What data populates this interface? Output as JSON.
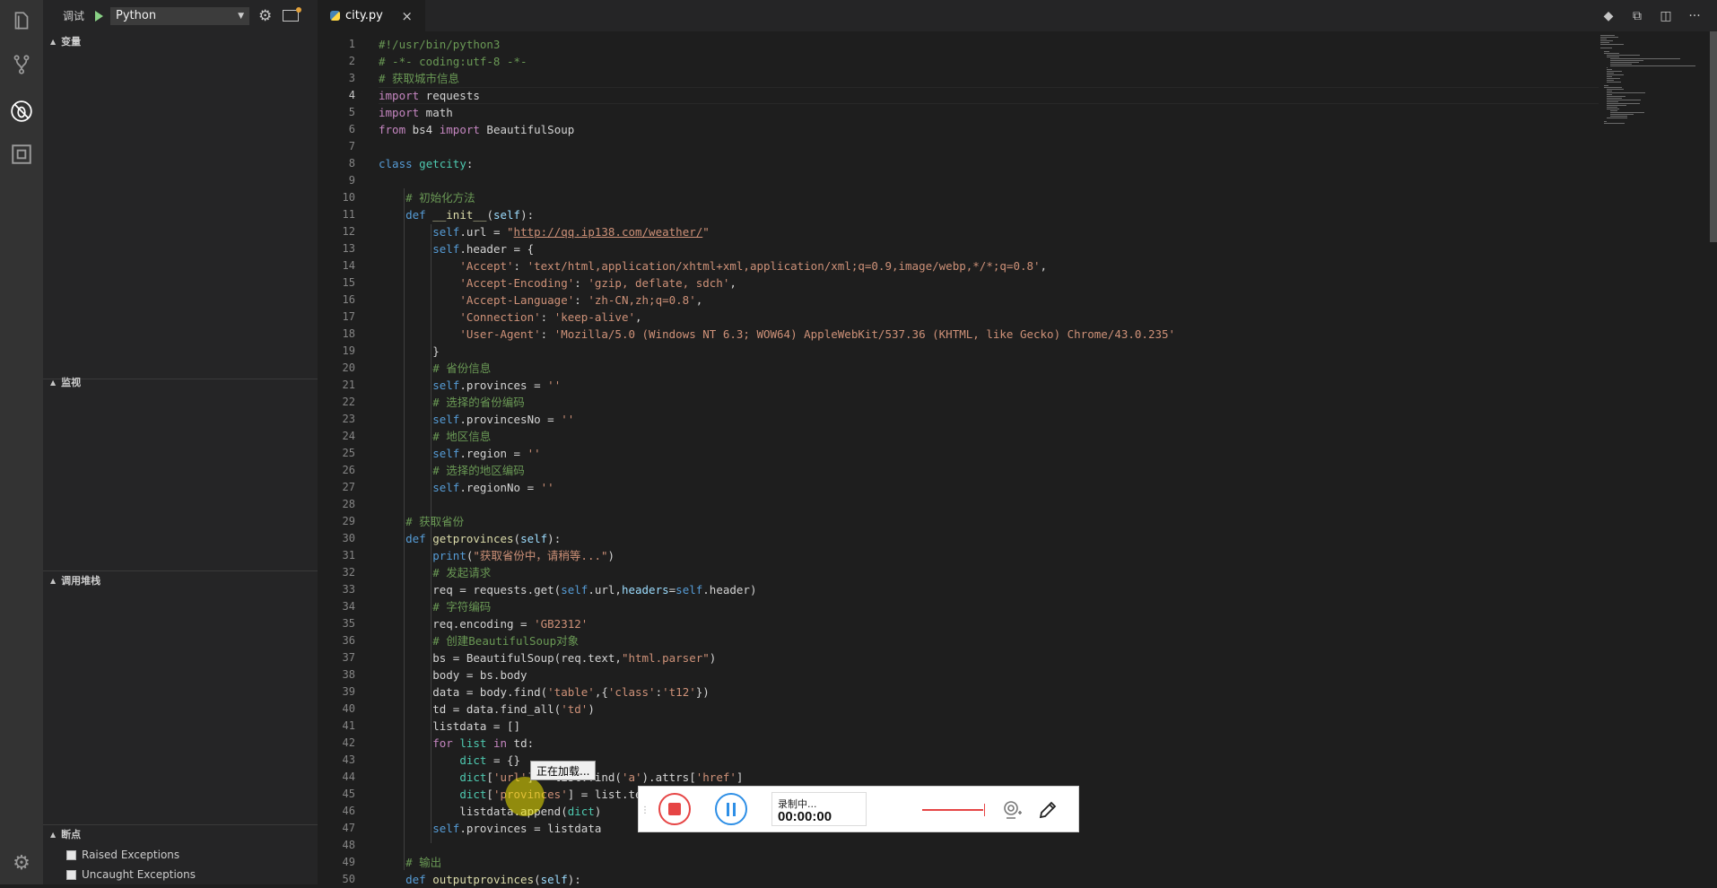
{
  "activity_bar": {
    "items": [
      "explorer-icon",
      "source-control-icon",
      "debug-icon",
      "extensions-icon"
    ],
    "active": "debug-icon",
    "settings": "gear-icon"
  },
  "debug_toolbar": {
    "label": "调试",
    "config": "Python"
  },
  "sidebar": {
    "sections": {
      "variables": "变量",
      "watch": "监视",
      "call_stack": "调用堆栈",
      "breakpoints": "断点"
    },
    "breakpoints": [
      {
        "label": "Raised Exceptions",
        "checked": false
      },
      {
        "label": "Uncaught Exceptions",
        "checked": false
      }
    ]
  },
  "tabs": [
    {
      "label": "city.py",
      "close": "×"
    }
  ],
  "editor": {
    "current_line": 4,
    "lines": [
      {
        "n": "1",
        "s": [
          {
            "t": "#!/usr/bin/python3",
            "c": "cm"
          }
        ]
      },
      {
        "n": "2",
        "s": [
          {
            "t": "# -*- coding:utf-8 -*-",
            "c": "cm"
          }
        ]
      },
      {
        "n": "3",
        "s": [
          {
            "t": "# 获取城市信息",
            "c": "cm"
          }
        ]
      },
      {
        "n": "4",
        "s": [
          {
            "t": "import",
            "c": "kw"
          },
          {
            "t": " requests"
          }
        ]
      },
      {
        "n": "5",
        "s": [
          {
            "t": "import",
            "c": "kw"
          },
          {
            "t": " math"
          }
        ]
      },
      {
        "n": "6",
        "s": [
          {
            "t": "from",
            "c": "kw"
          },
          {
            "t": " bs4 "
          },
          {
            "t": "import",
            "c": "kw"
          },
          {
            "t": " BeautifulSoup"
          }
        ]
      },
      {
        "n": "7",
        "s": []
      },
      {
        "n": "8",
        "s": [
          {
            "t": "class",
            "c": "kb"
          },
          {
            "t": " "
          },
          {
            "t": "getcity",
            "c": "cls"
          },
          {
            "t": ":"
          }
        ]
      },
      {
        "n": "9",
        "s": []
      },
      {
        "n": "10",
        "s": [
          {
            "t": "    "
          },
          {
            "t": "# 初始化方法",
            "c": "cm"
          }
        ]
      },
      {
        "n": "11",
        "s": [
          {
            "t": "    "
          },
          {
            "t": "def",
            "c": "kb"
          },
          {
            "t": " "
          },
          {
            "t": "__init__",
            "c": "fn"
          },
          {
            "t": "("
          },
          {
            "t": "self",
            "c": "var"
          },
          {
            "t": "):"
          }
        ]
      },
      {
        "n": "12",
        "s": [
          {
            "t": "        "
          },
          {
            "t": "self",
            "c": "kb"
          },
          {
            "t": ".url = "
          },
          {
            "t": "\"",
            "c": "str"
          },
          {
            "t": "http://qq.ip138.com/weather/",
            "c": "str lnk"
          },
          {
            "t": "\"",
            "c": "str"
          }
        ]
      },
      {
        "n": "13",
        "s": [
          {
            "t": "        "
          },
          {
            "t": "self",
            "c": "kb"
          },
          {
            "t": ".header = {"
          }
        ]
      },
      {
        "n": "14",
        "s": [
          {
            "t": "            "
          },
          {
            "t": "'Accept'",
            "c": "str"
          },
          {
            "t": ": "
          },
          {
            "t": "'text/html,application/xhtml+xml,application/xml;q=0.9,image/webp,*/*;q=0.8'",
            "c": "str"
          },
          {
            "t": ","
          }
        ]
      },
      {
        "n": "15",
        "s": [
          {
            "t": "            "
          },
          {
            "t": "'Accept-Encoding'",
            "c": "str"
          },
          {
            "t": ": "
          },
          {
            "t": "'gzip, deflate, sdch'",
            "c": "str"
          },
          {
            "t": ","
          }
        ]
      },
      {
        "n": "16",
        "s": [
          {
            "t": "            "
          },
          {
            "t": "'Accept-Language'",
            "c": "str"
          },
          {
            "t": ": "
          },
          {
            "t": "'zh-CN,zh;q=0.8'",
            "c": "str"
          },
          {
            "t": ","
          }
        ]
      },
      {
        "n": "17",
        "s": [
          {
            "t": "            "
          },
          {
            "t": "'Connection'",
            "c": "str"
          },
          {
            "t": ": "
          },
          {
            "t": "'keep-alive'",
            "c": "str"
          },
          {
            "t": ","
          }
        ]
      },
      {
        "n": "18",
        "s": [
          {
            "t": "            "
          },
          {
            "t": "'User-Agent'",
            "c": "str"
          },
          {
            "t": ": "
          },
          {
            "t": "'Mozilla/5.0 (Windows NT 6.3; WOW64) AppleWebKit/537.36 (KHTML, like Gecko) Chrome/43.0.235'",
            "c": "str"
          }
        ]
      },
      {
        "n": "19",
        "s": [
          {
            "t": "        }"
          }
        ]
      },
      {
        "n": "20",
        "s": [
          {
            "t": "        "
          },
          {
            "t": "# 省份信息",
            "c": "cm"
          }
        ]
      },
      {
        "n": "21",
        "s": [
          {
            "t": "        "
          },
          {
            "t": "self",
            "c": "kb"
          },
          {
            "t": ".provinces = "
          },
          {
            "t": "''",
            "c": "str"
          }
        ]
      },
      {
        "n": "22",
        "s": [
          {
            "t": "        "
          },
          {
            "t": "# 选择的省份编码",
            "c": "cm"
          }
        ]
      },
      {
        "n": "23",
        "s": [
          {
            "t": "        "
          },
          {
            "t": "self",
            "c": "kb"
          },
          {
            "t": ".provincesNo = "
          },
          {
            "t": "''",
            "c": "str"
          }
        ]
      },
      {
        "n": "24",
        "s": [
          {
            "t": "        "
          },
          {
            "t": "# 地区信息",
            "c": "cm"
          }
        ]
      },
      {
        "n": "25",
        "s": [
          {
            "t": "        "
          },
          {
            "t": "self",
            "c": "kb"
          },
          {
            "t": ".region = "
          },
          {
            "t": "''",
            "c": "str"
          }
        ]
      },
      {
        "n": "26",
        "s": [
          {
            "t": "        "
          },
          {
            "t": "# 选择的地区编码",
            "c": "cm"
          }
        ]
      },
      {
        "n": "27",
        "s": [
          {
            "t": "        "
          },
          {
            "t": "self",
            "c": "kb"
          },
          {
            "t": ".regionNo = "
          },
          {
            "t": "''",
            "c": "str"
          }
        ]
      },
      {
        "n": "28",
        "s": []
      },
      {
        "n": "29",
        "s": [
          {
            "t": "    "
          },
          {
            "t": "# 获取省份",
            "c": "cm"
          }
        ]
      },
      {
        "n": "30",
        "s": [
          {
            "t": "    "
          },
          {
            "t": "def",
            "c": "kb"
          },
          {
            "t": " "
          },
          {
            "t": "getprovinces",
            "c": "fn"
          },
          {
            "t": "("
          },
          {
            "t": "self",
            "c": "var"
          },
          {
            "t": "):"
          }
        ]
      },
      {
        "n": "31",
        "s": [
          {
            "t": "        "
          },
          {
            "t": "print",
            "c": "kb"
          },
          {
            "t": "("
          },
          {
            "t": "\"获取省份中，请稍等...\"",
            "c": "str"
          },
          {
            "t": ")"
          }
        ]
      },
      {
        "n": "32",
        "s": [
          {
            "t": "        "
          },
          {
            "t": "# 发起请求",
            "c": "cm"
          }
        ]
      },
      {
        "n": "33",
        "s": [
          {
            "t": "        req = requests.get("
          },
          {
            "t": "self",
            "c": "kb"
          },
          {
            "t": ".url,"
          },
          {
            "t": "headers",
            "c": "var"
          },
          {
            "t": "="
          },
          {
            "t": "self",
            "c": "kb"
          },
          {
            "t": ".header)"
          }
        ]
      },
      {
        "n": "34",
        "s": [
          {
            "t": "        "
          },
          {
            "t": "# 字符编码",
            "c": "cm"
          }
        ]
      },
      {
        "n": "35",
        "s": [
          {
            "t": "        req.encoding = "
          },
          {
            "t": "'GB2312'",
            "c": "str"
          }
        ]
      },
      {
        "n": "36",
        "s": [
          {
            "t": "        "
          },
          {
            "t": "# 创建BeautifulSoup对象",
            "c": "cm"
          }
        ]
      },
      {
        "n": "37",
        "s": [
          {
            "t": "        bs = BeautifulSoup(req.text,"
          },
          {
            "t": "\"html.parser\"",
            "c": "str"
          },
          {
            "t": ")"
          }
        ]
      },
      {
        "n": "38",
        "s": [
          {
            "t": "        body = bs.body"
          }
        ]
      },
      {
        "n": "39",
        "s": [
          {
            "t": "        data = body.find("
          },
          {
            "t": "'table'",
            "c": "str"
          },
          {
            "t": ",{"
          },
          {
            "t": "'class'",
            "c": "str"
          },
          {
            "t": ":"
          },
          {
            "t": "'t12'",
            "c": "str"
          },
          {
            "t": "})"
          }
        ]
      },
      {
        "n": "40",
        "s": [
          {
            "t": "        td = data.find_all("
          },
          {
            "t": "'td'",
            "c": "str"
          },
          {
            "t": ")"
          }
        ]
      },
      {
        "n": "41",
        "s": [
          {
            "t": "        listdata = []"
          }
        ]
      },
      {
        "n": "42",
        "s": [
          {
            "t": "        "
          },
          {
            "t": "for",
            "c": "kw"
          },
          {
            "t": " "
          },
          {
            "t": "list",
            "c": "cls"
          },
          {
            "t": " "
          },
          {
            "t": "in",
            "c": "kw"
          },
          {
            "t": " td:"
          }
        ]
      },
      {
        "n": "43",
        "s": [
          {
            "t": "            "
          },
          {
            "t": "dict",
            "c": "cls"
          },
          {
            "t": " = {}"
          }
        ]
      },
      {
        "n": "44",
        "s": [
          {
            "t": "            "
          },
          {
            "t": "dict",
            "c": "cls"
          },
          {
            "t": "["
          },
          {
            "t": "'url'",
            "c": "str"
          },
          {
            "t": "] = list.find("
          },
          {
            "t": "'a'",
            "c": "str"
          },
          {
            "t": ").attrs["
          },
          {
            "t": "'href'",
            "c": "str"
          },
          {
            "t": "]"
          }
        ]
      },
      {
        "n": "45",
        "s": [
          {
            "t": "            "
          },
          {
            "t": "dict",
            "c": "cls"
          },
          {
            "t": "["
          },
          {
            "t": "'provinces'",
            "c": "str"
          },
          {
            "t": "] = list.text"
          }
        ]
      },
      {
        "n": "46",
        "s": [
          {
            "t": "            listdata.append("
          },
          {
            "t": "dict",
            "c": "cls"
          },
          {
            "t": ")"
          }
        ]
      },
      {
        "n": "47",
        "s": [
          {
            "t": "        "
          },
          {
            "t": "self",
            "c": "kb"
          },
          {
            "t": ".provinces = listdata"
          }
        ]
      },
      {
        "n": "48",
        "s": []
      },
      {
        "n": "49",
        "s": [
          {
            "t": "    "
          },
          {
            "t": "# 输出",
            "c": "cm"
          }
        ]
      },
      {
        "n": "50",
        "s": [
          {
            "t": "    "
          },
          {
            "t": "def",
            "c": "kb"
          },
          {
            "t": " "
          },
          {
            "t": "outputprovinces",
            "c": "fn"
          },
          {
            "t": "("
          },
          {
            "t": "self",
            "c": "var"
          },
          {
            "t": "):"
          }
        ]
      }
    ]
  },
  "overlay": {
    "loading_tooltip": "正在加载..."
  },
  "recorder": {
    "status": "录制中...",
    "time": "00:00:00",
    "accent_stop": "#e64545",
    "accent_pause": "#2e8fe6"
  }
}
